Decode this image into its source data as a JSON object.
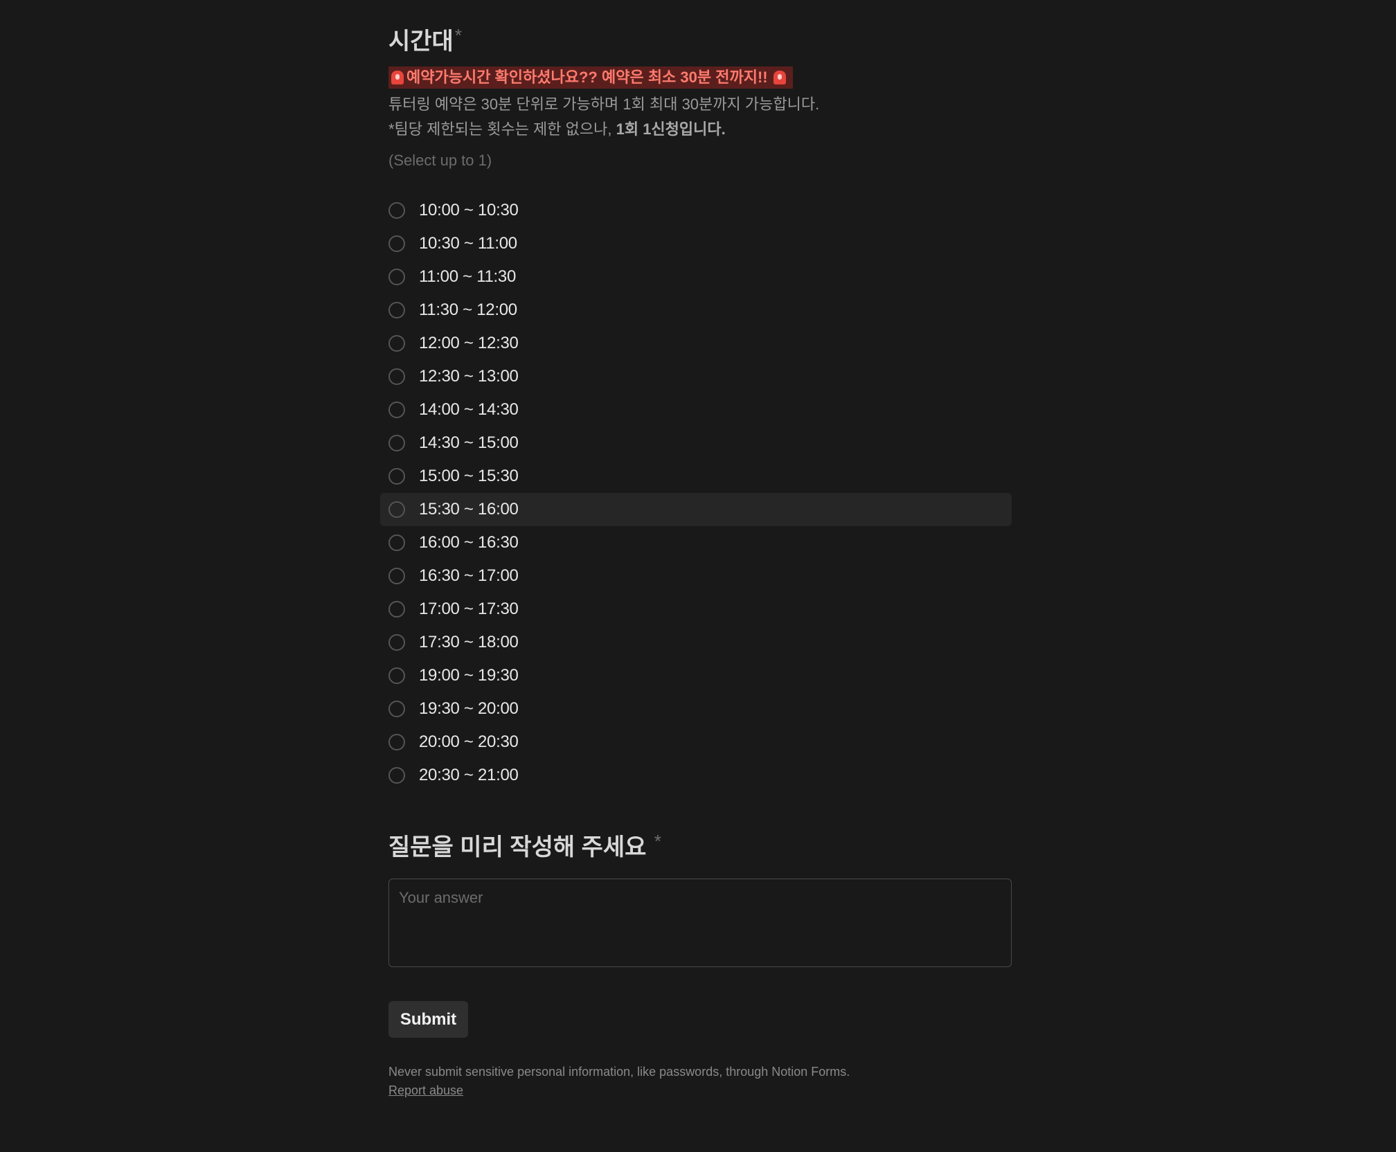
{
  "question1": {
    "title": "시간대",
    "required_mark": "*",
    "alert_text": "예약가능시간 확인하셨나요?? 예약은 최소 30분 전까지!!",
    "alert_icon": "siren-icon",
    "description_line1": "튜터링 예약은 30분 단위로 가능하며 1회 최대 30분까지 가능합니다.",
    "description_line2_prefix": "*팀당 제한되는 횟수는 제한 없으나, ",
    "description_line2_bold": "1회 1신청입니다.",
    "hint": "(Select up to 1)",
    "options": [
      "10:00 ~ 10:30",
      "10:30 ~ 11:00",
      "11:00 ~ 11:30",
      "11:30 ~ 12:00",
      "12:00 ~ 12:30",
      "12:30 ~ 13:00",
      "14:00 ~ 14:30",
      "14:30 ~ 15:00",
      "15:00 ~ 15:30",
      "15:30 ~ 16:00",
      "16:00 ~ 16:30",
      "16:30 ~ 17:00",
      "17:00 ~ 17:30",
      "17:30 ~ 18:00",
      "19:00 ~ 19:30",
      "19:30 ~ 20:00",
      "20:00 ~ 20:30",
      "20:30 ~ 21:00"
    ],
    "hovered_option": "15:30 ~ 16:00"
  },
  "question2": {
    "title": "질문을 미리 작성해 주세요",
    "required_mark": "*",
    "placeholder": "Your answer",
    "value": ""
  },
  "submit_label": "Submit",
  "footer": {
    "note": "Never submit sensitive personal information, like passwords, through Notion Forms.",
    "report_link": "Report abuse"
  },
  "colors": {
    "background": "#191919",
    "alert_bg": "#5a1f1d",
    "alert_text": "#ff7b6e",
    "hover_bg": "#262626",
    "button_bg": "#2f2f2f"
  }
}
